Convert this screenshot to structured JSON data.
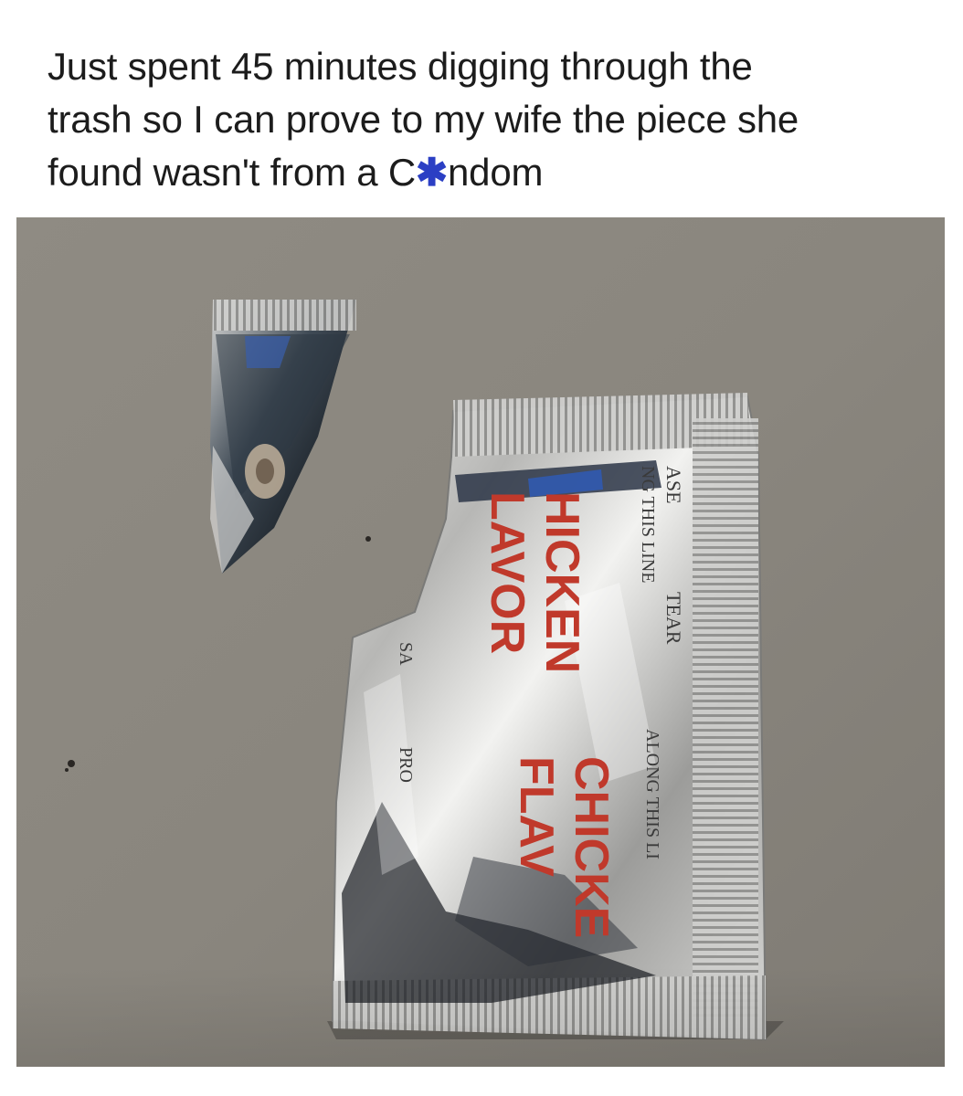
{
  "post": {
    "caption_lines": [
      "Just spent 45 minutes digging through the",
      "trash so I can prove to my wife the piece she"
    ],
    "caption_line3_before": "found wasn't from a C",
    "censor_glyph": "✱",
    "caption_line3_after": "ndom",
    "censor_color": "#2b3fc4"
  },
  "photo": {
    "packet_texts": {
      "brand_1": "HICKEN",
      "brand_2": "LAVOR",
      "brand_3": "CHICKE",
      "brand_4": "FLAV",
      "tear_1": "ASE",
      "tear_2": "TEAR",
      "tear_3": "NG THIS LINE",
      "tear_4": "ALONG THIS LI",
      "origin": "SA",
      "product": "PRO"
    },
    "colors": {
      "surface": "#8e8a82",
      "foil": "#c9c9c7",
      "lettering": "#c0392b"
    }
  }
}
